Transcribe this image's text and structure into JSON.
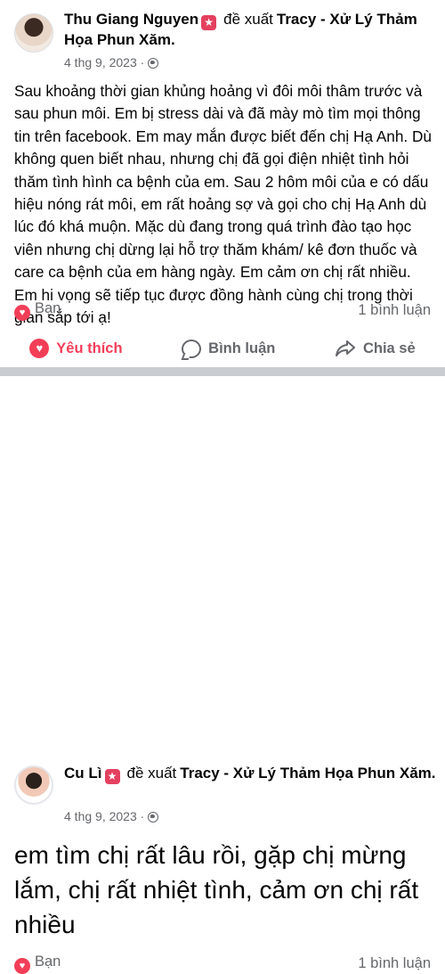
{
  "posts": [
    {
      "author": "Thu Giang Nguyen",
      "badge_icon": "recommendation-star-icon",
      "verb": "đề xuất",
      "page": "Tracy - Xử Lý Thảm Họa Phun Xăm.",
      "date": "4 thg 9, 2023 ·",
      "privacy_icon": "globe-icon",
      "text": "Sau khoảng thời gian khủng hoảng vì đôi môi thâm trước và sau phun môi. Em bị stress dài và đã mày mò tìm mọi thông tin trên facebook. Em may mắn được biết đến chị Hạ Anh. Dù không quen biết nhau, nhưng chị đã gọi điện nhiệt tình hỏi thăm tình hình ca bệnh của em. Sau 2 hôm môi của e có dấu hiệu nóng rát môi, em rất hoảng sợ và gọi cho chị Hạ Anh dù lúc đó khá muộn. Mặc dù đang trong quá trình đào tạo học viên nhưng chị dừng lại hỗ trợ thăm khám/ kê đơn thuốc và care ca bệnh của em hàng ngày.  Em cảm ơn chị rất nhiều. Em hi vọng sẽ tiếp tục được đồng hành cùng chị trong thời gian sắp tới ạ!",
      "reaction_label": "Bạn",
      "comments": "1 bình luận"
    },
    {
      "author": "Cu Lì",
      "badge_icon": "recommendation-star-icon",
      "verb": "đề xuất",
      "page": "Tracy - Xử Lý Thảm Họa Phun Xăm.",
      "date": "4 thg 9, 2023 ·",
      "privacy_icon": "globe-icon",
      "text": "em tìm chị rất lâu rồi, gặp chị mừng lắm, chị rất nhiệt tình, cảm ơn chị rất nhiều",
      "reaction_label": "Bạn",
      "comments": "1 bình luận"
    }
  ],
  "actions": {
    "like": "Yêu thích",
    "comment": "Bình luận",
    "share": "Chia sẻ"
  },
  "colors": {
    "accent": "#f33e58",
    "badge": "#e4405f",
    "muted": "#65676b",
    "divider": "#c9ccd1"
  }
}
